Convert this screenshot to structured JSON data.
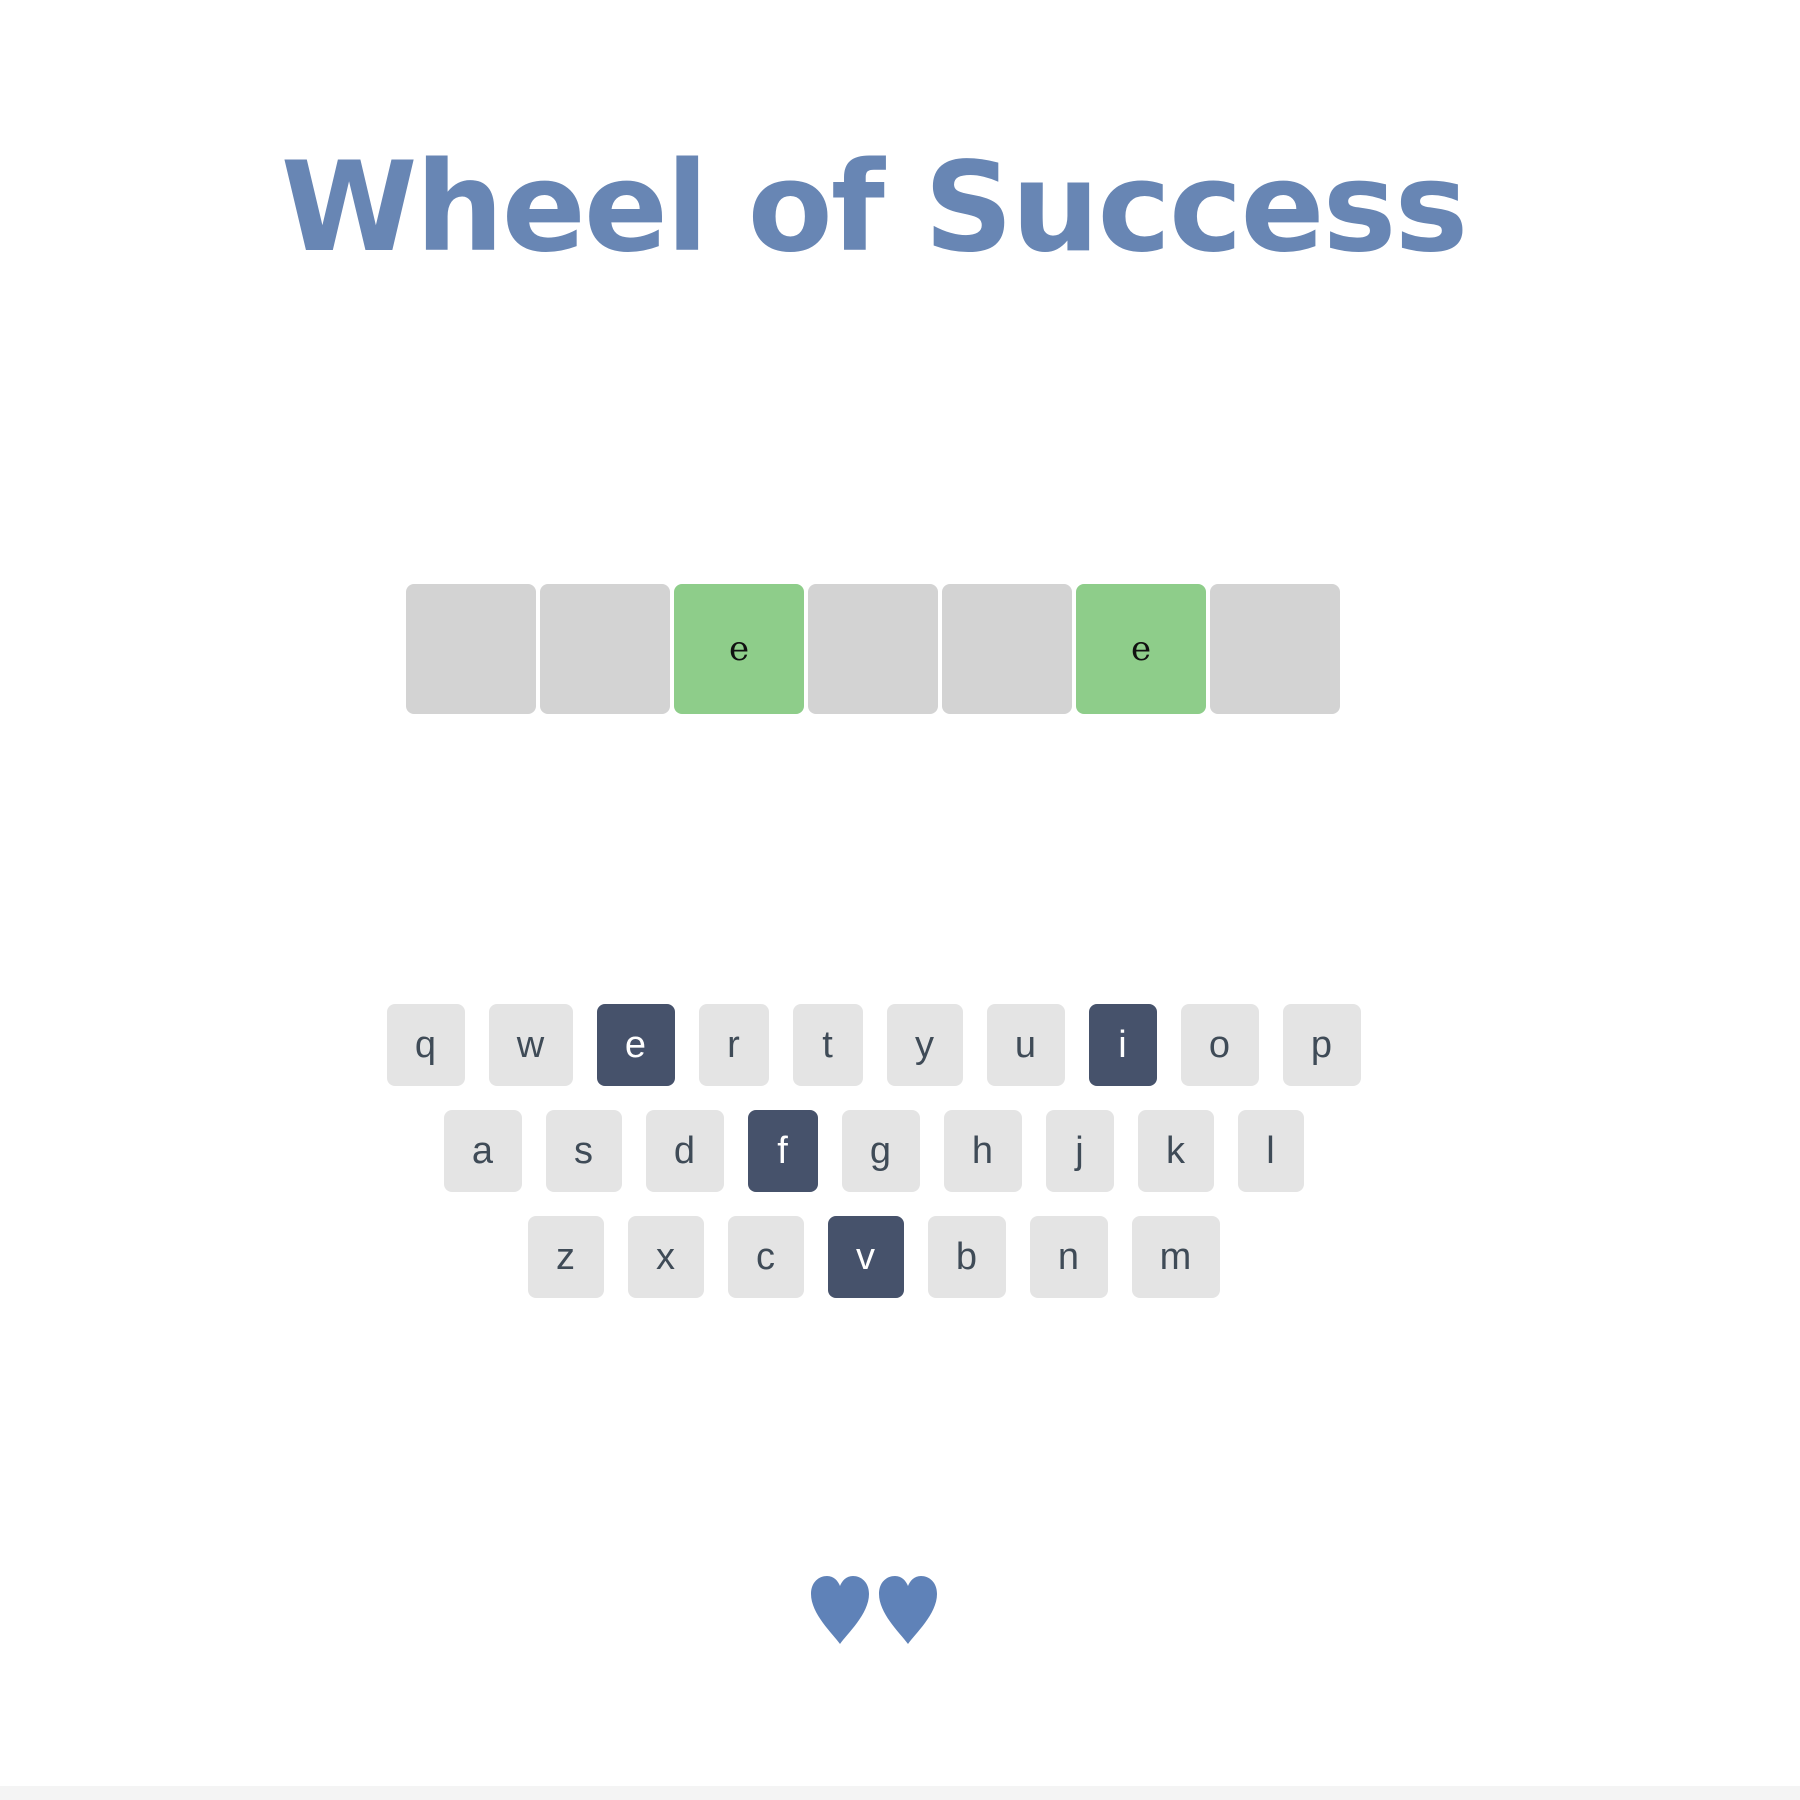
{
  "title": "Wheel of Success",
  "puzzle": {
    "tiles": [
      "",
      "",
      "e",
      "",
      "",
      "e",
      ""
    ]
  },
  "keyboard": {
    "rows": [
      [
        "q",
        "w",
        "e",
        "r",
        "t",
        "y",
        "u",
        "i",
        "o",
        "p"
      ],
      [
        "a",
        "s",
        "d",
        "f",
        "g",
        "h",
        "j",
        "k",
        "l"
      ],
      [
        "z",
        "x",
        "c",
        "v",
        "b",
        "n",
        "m"
      ]
    ],
    "used": [
      "e",
      "i",
      "f",
      "v"
    ]
  },
  "lives": {
    "remaining": 2,
    "icon": "heart-icon"
  },
  "colors": {
    "title": "#6886b4",
    "tile_hidden": "#d3d3d3",
    "tile_revealed": "#8ecd8a",
    "key_default": "#e4e4e4",
    "key_used": "#46526b",
    "heart": "#5f82b8"
  }
}
